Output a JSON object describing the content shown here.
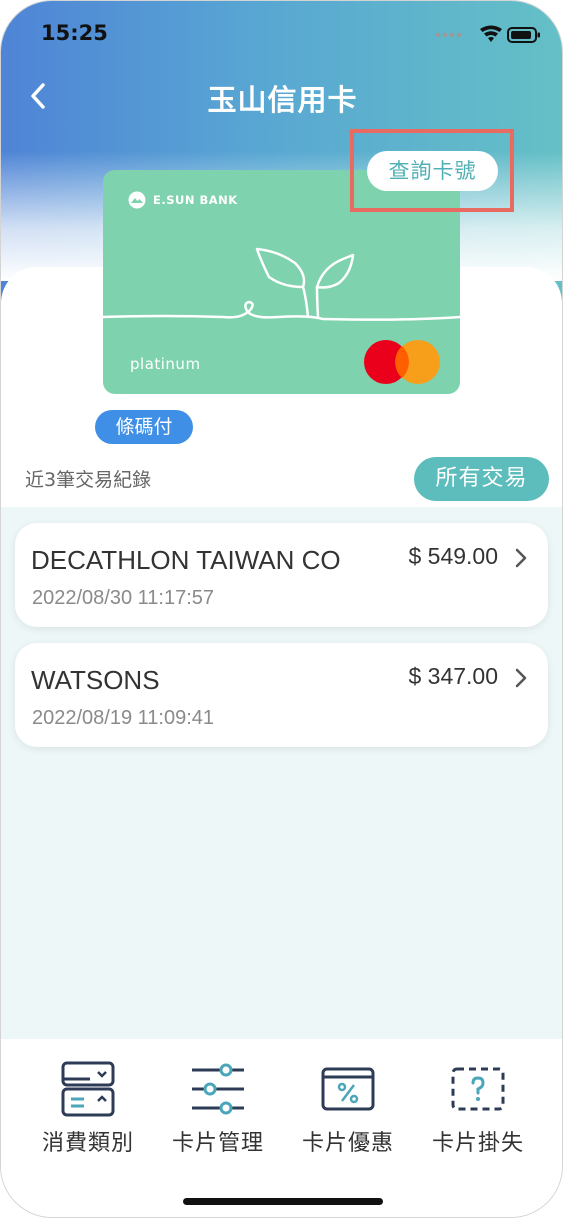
{
  "status_bar": {
    "time": "15:25"
  },
  "header": {
    "title": "玉山信用卡"
  },
  "card": {
    "brand": "E.SUN BANK",
    "tier": "platinum",
    "query_button": "查詢卡號",
    "barcode_button": "條碼付"
  },
  "transactions_section": {
    "label": "近3筆交易紀錄",
    "all_button": "所有交易"
  },
  "transactions": [
    {
      "merchant": "DECATHLON TAIWAN CO",
      "datetime": "2022/08/30 11:17:57",
      "amount": "$ 549.00"
    },
    {
      "merchant": "WATSONS",
      "datetime": "2022/08/19 11:09:41",
      "amount": "$ 347.00"
    }
  ],
  "bottom_nav": [
    {
      "label": "消費類別",
      "icon": "spending-category-icon"
    },
    {
      "label": "卡片管理",
      "icon": "sliders-icon"
    },
    {
      "label": "卡片優惠",
      "icon": "discount-icon"
    },
    {
      "label": "卡片掛失",
      "icon": "lost-card-icon"
    }
  ],
  "colors": {
    "accent_teal": "#5dbcbc",
    "barcode_blue": "#3f8fe6",
    "card_green": "#7ed2ad",
    "highlight_red": "#e76b60"
  }
}
